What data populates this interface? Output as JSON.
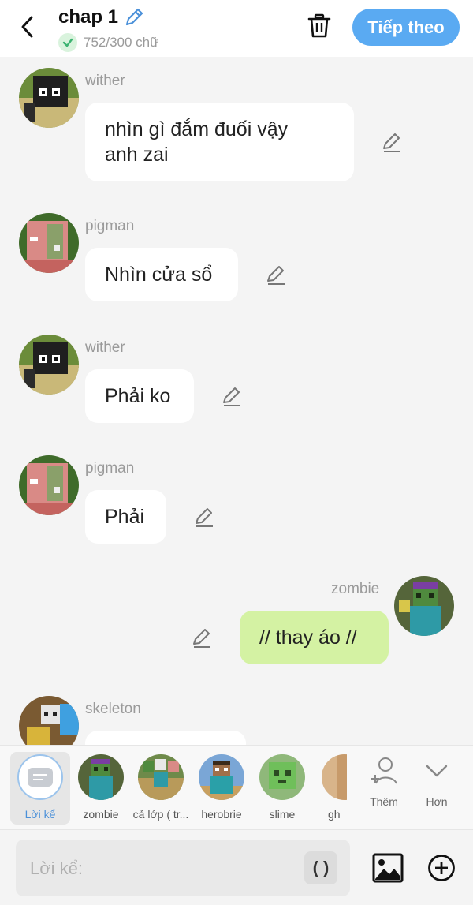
{
  "header": {
    "title": "chap 1",
    "word_count": "752/300 chữ",
    "next_label": "Tiếp theo",
    "accent": "#5aaaf2"
  },
  "messages": [
    {
      "name": "wither",
      "text_lines": [
        "nhìn gì đắm đuối vậy",
        "anh zai"
      ],
      "side": "left",
      "avatar": "wither"
    },
    {
      "name": "pigman",
      "text_lines": [
        "Nhìn cửa sổ"
      ],
      "side": "left",
      "avatar": "pigman"
    },
    {
      "name": "wither",
      "text_lines": [
        "Phải ko"
      ],
      "side": "left",
      "avatar": "wither"
    },
    {
      "name": "pigman",
      "text_lines": [
        "Phải"
      ],
      "side": "left",
      "avatar": "pigman"
    },
    {
      "name": "zombie",
      "text_lines": [
        "// thay áo //"
      ],
      "side": "right",
      "avatar": "zombie",
      "bubble_color": "#d4f2a3"
    },
    {
      "name": "skeleton",
      "text_lines": [
        ""
      ],
      "side": "left",
      "avatar": "skeleton"
    }
  ],
  "characters": [
    {
      "label": "Lời kể",
      "selected": true
    },
    {
      "label": "zombie"
    },
    {
      "label": "cả lớp ( tr..."
    },
    {
      "label": "herobrie"
    },
    {
      "label": "slime"
    },
    {
      "label": "gh"
    }
  ],
  "actions": {
    "add_label": "Thêm",
    "more_label": "Hơn"
  },
  "input": {
    "placeholder": "Lời kể:",
    "paren_label": "( )"
  }
}
